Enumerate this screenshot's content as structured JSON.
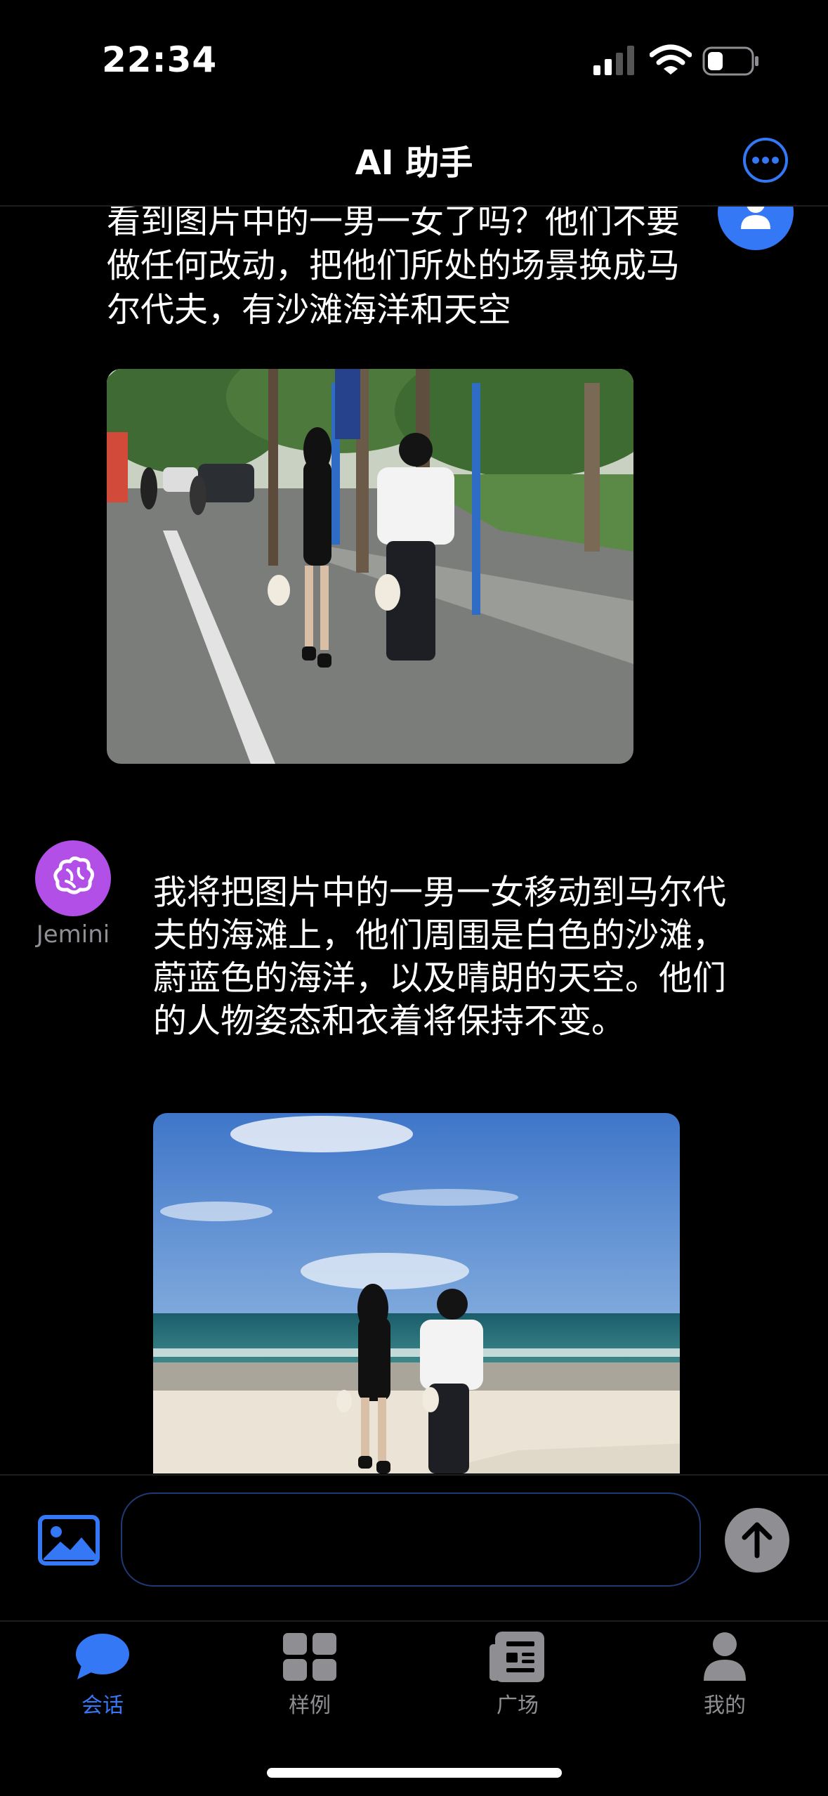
{
  "status_bar": {
    "time": "22:34"
  },
  "header": {
    "title": "AI 助手",
    "more_icon": "ellipsis-circle-icon"
  },
  "conversation": {
    "user_message": "看到图片中的一男一女了吗？他们不要做任何改动，把他们所处的场景换成马尔代夫，有沙滩海洋和天空",
    "bot_name": "Jemini",
    "bot_message": "我将把图片中的一男一女移动到马尔代夫的海滩上，他们周围是白色的沙滩，蔚蓝色的海洋，以及晴朗的天空。他们的人物姿态和衣着将保持不变。"
  },
  "input": {
    "value": "",
    "placeholder": ""
  },
  "tabs": [
    {
      "label": "会话",
      "icon": "chat-bubble-icon",
      "active": true
    },
    {
      "label": "样例",
      "icon": "grid-icon",
      "active": false
    },
    {
      "label": "广场",
      "icon": "newspaper-icon",
      "active": false
    },
    {
      "label": "我的",
      "icon": "person-icon",
      "active": false
    }
  ],
  "colors": {
    "accent": "#3478f6",
    "bot_avatar": "#b14fe6",
    "inactive": "#8e8e93",
    "send_button": "#8e8e93"
  }
}
